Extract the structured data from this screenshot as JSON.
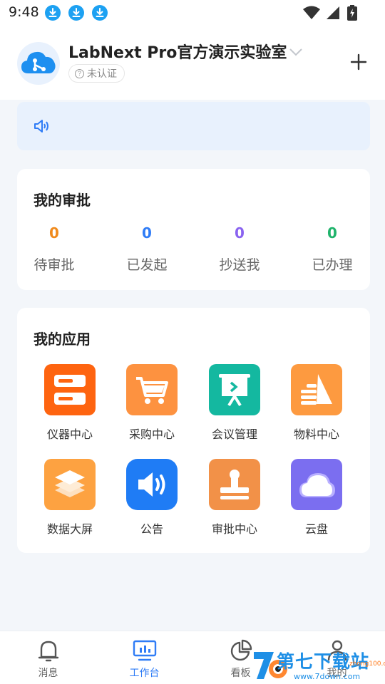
{
  "status_bar": {
    "time": "9:48"
  },
  "header": {
    "org_name": "LabNext Pro官方演示实验室",
    "cert_status": "未认证"
  },
  "notice": {
    "text": ""
  },
  "approvals": {
    "title": "我的审批",
    "items": [
      {
        "count": "0",
        "label": "待审批",
        "color": "#f08a1c"
      },
      {
        "count": "0",
        "label": "已发起",
        "color": "#2f7cf6"
      },
      {
        "count": "0",
        "label": "抄送我",
        "color": "#8a63f0"
      },
      {
        "count": "0",
        "label": "已办理",
        "color": "#1fb36b"
      }
    ]
  },
  "apps": {
    "title": "我的应用",
    "items": [
      {
        "label": "仪器中心",
        "icon": "server-icon",
        "color": "#fe6410"
      },
      {
        "label": "采购中心",
        "icon": "cart-icon",
        "color": "#fd9240"
      },
      {
        "label": "会议管理",
        "icon": "presentation-icon",
        "color": "#14b8a0"
      },
      {
        "label": "物料中心",
        "icon": "flask-icon",
        "color": "#fd9a40"
      },
      {
        "label": "数据大屏",
        "icon": "layers-icon",
        "color": "#fda241"
      },
      {
        "label": "公告",
        "icon": "speaker-icon",
        "color": "#1f7cf5"
      },
      {
        "label": "审批中心",
        "icon": "stamp-icon",
        "color": "#f29148"
      },
      {
        "label": "云盘",
        "icon": "cloud-icon",
        "color": "#7b6ef0"
      }
    ]
  },
  "nav": {
    "active_color": "#2f7cf6",
    "items": [
      {
        "label": "消息",
        "icon": "bell-icon",
        "active": false
      },
      {
        "label": "工作台",
        "icon": "monitor-icon",
        "active": true
      },
      {
        "label": "看板",
        "icon": "pie-chart-icon",
        "active": false
      },
      {
        "label": "我的",
        "icon": "person-icon",
        "active": false
      }
    ]
  },
  "watermark": {
    "text": "第七下载站",
    "url": "www.7down.com",
    "url2": "zhong100.com"
  }
}
